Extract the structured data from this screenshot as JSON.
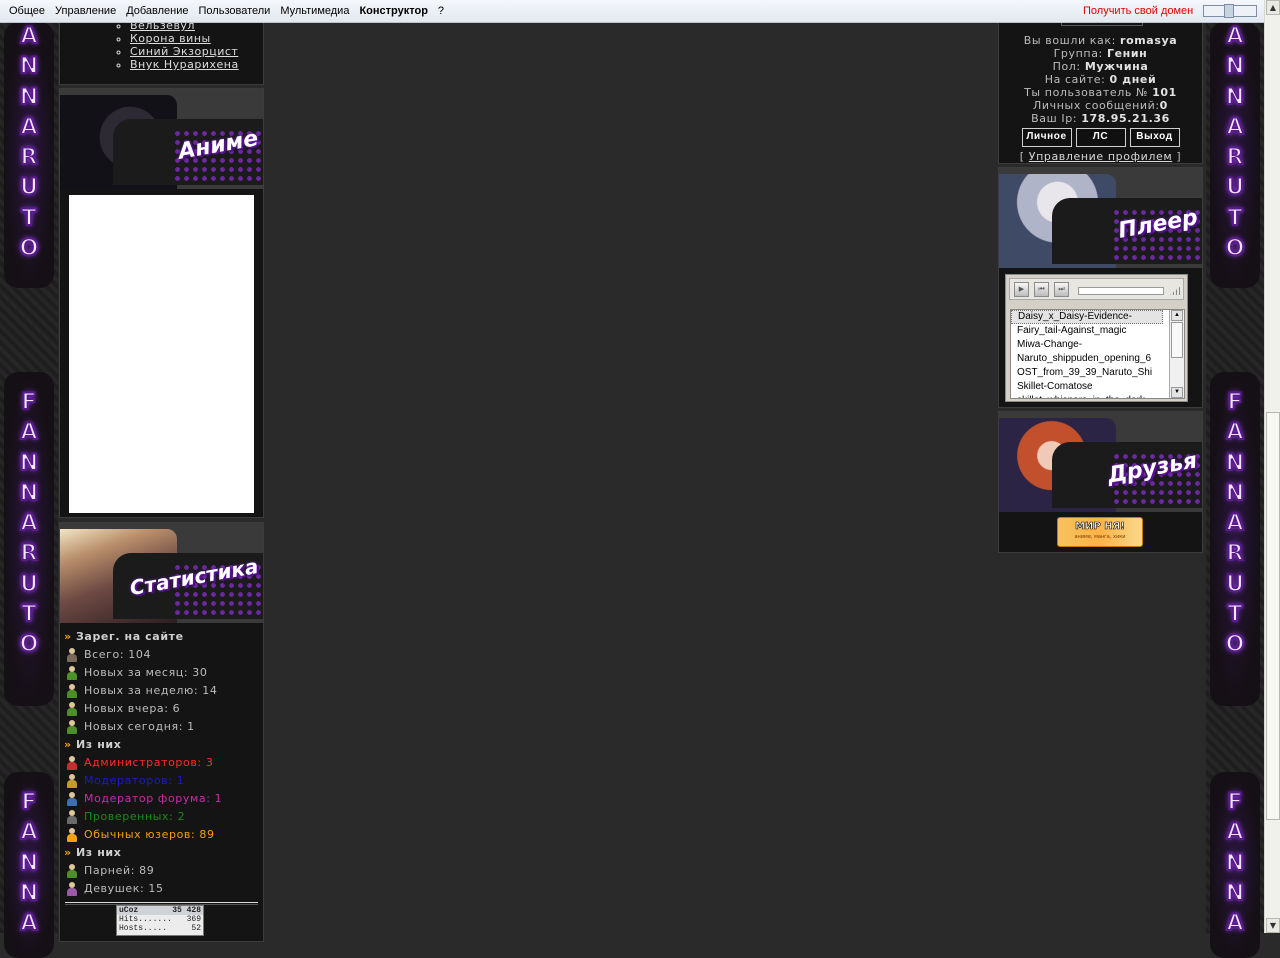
{
  "topbar": {
    "menu": [
      "Общее",
      "Управление",
      "Добавление",
      "Пользователи",
      "Мультимедиа",
      "Конструктор",
      "?"
    ],
    "get_domain": "Получить свой домен"
  },
  "side_text": [
    "A",
    "N",
    "N",
    "A",
    "R",
    "U",
    "T",
    "O",
    "F",
    "A",
    "N",
    "N",
    "A",
    "R",
    "U",
    "T",
    "O"
  ],
  "sections_list": [
    "Вельзевул",
    "Корона вины",
    "Синий Экзорцист",
    "Внук Нурарихена"
  ],
  "anime_panel": {
    "title": "Аниме"
  },
  "stats_panel": {
    "title": "Статистика",
    "reg_heading": "Зарег. на сайте",
    "rows1": [
      {
        "text": "Всего: 104",
        "color": "#bdbdbd"
      },
      {
        "text": "Новых за месяц: 30",
        "color": "#bdbdbd"
      },
      {
        "text": "Новых за неделю: 14",
        "color": "#bdbdbd"
      },
      {
        "text": "Новых вчера: 6",
        "color": "#bdbdbd"
      },
      {
        "text": "Новых сегодня: 1",
        "color": "#bdbdbd"
      }
    ],
    "of_them_1": "Из них",
    "rows2": [
      {
        "text": "Администраторов: 3",
        "color": "#ff2a2a"
      },
      {
        "text": "Модераторов: 1",
        "color": "#1a1acc"
      },
      {
        "text": "Модератор форума: 1",
        "color": "#cc2aa8"
      },
      {
        "text": "Проверенных: 2",
        "color": "#1c8a1c"
      },
      {
        "text": "Обычных юзеров: 89",
        "color": "#f2a011"
      }
    ],
    "of_them_2": "Из них",
    "rows3": [
      {
        "text": "Парней: 89",
        "color": "#bdbdbd"
      },
      {
        "text": "Девушек: 15",
        "color": "#bdbdbd"
      }
    ],
    "counter": {
      "brand": "uCoz",
      "total": "35 428",
      "hits_label": "Hits.......",
      "hits": "369",
      "hosts_label": "Hosts.....",
      "hosts": "52"
    }
  },
  "user_panel": {
    "logged_as_label": "Вы вошли как:",
    "logged_as": "romasya",
    "group_label": "Группа:",
    "group": "Генин",
    "gender_label": "Пол:",
    "gender": "Мужчина",
    "on_site_label": "На сайте:",
    "on_site": "0 дней",
    "user_num_label": "Ты пользователь №",
    "user_num": "101",
    "pm_label": "Личных сообщений:",
    "pm": "0",
    "ip_label": "Ваш Ip:",
    "ip": "178.95.21.36",
    "buttons": [
      "Личное",
      "ЛС",
      "Выход"
    ],
    "manage_profile": "Управление профилем",
    "bracket_open": "[",
    "bracket_close": "]"
  },
  "player_panel": {
    "title": "Плеер",
    "tracks": [
      "Daisy_x_Daisy-Evidence-",
      "Fairy_tail-Against_magic",
      "Miwa-Change-",
      "Naruto_shippuden_opening_6",
      "OST_from_39_39_Naruto_Shi",
      "Skillet-Comatose",
      "skillet_whispers_in_the_dark"
    ]
  },
  "friends_panel": {
    "title": "Друзья",
    "banner_title": "МИР НЯ!",
    "banner_sub": "аниме, манга, хики"
  }
}
